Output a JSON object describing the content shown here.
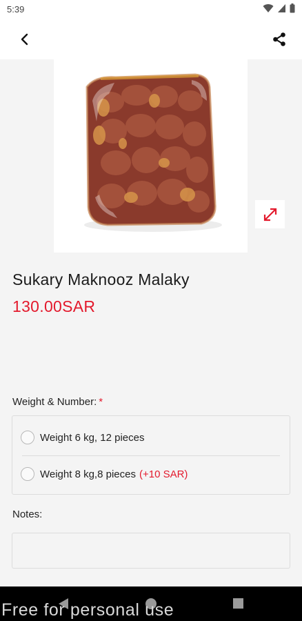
{
  "status_bar": {
    "time": "5:39",
    "icons": [
      "wifi-icon",
      "signal-icon",
      "battery-icon"
    ]
  },
  "app_bar": {
    "back_icon": "back-arrow-icon",
    "share_icon": "share-icon"
  },
  "product": {
    "image": "vacuum-packed dates product photo",
    "zoom_icon": "expand-diagonal-icon",
    "title": "Sukary Maknooz Malaky",
    "price": "130.00SAR"
  },
  "weight_section": {
    "label": "Weight & Number:",
    "required_mark": "*",
    "options": [
      {
        "label": "Weight 6 kg, 12 pieces",
        "extra": "",
        "selected": false
      },
      {
        "label": "Weight 8 kg,8 pieces",
        "extra": "(+10 SAR)",
        "selected": false
      }
    ]
  },
  "notes_section": {
    "label": "Notes:",
    "value": "",
    "placeholder": ""
  },
  "nav_bar": {
    "icons": [
      "nav-back-icon",
      "nav-home-icon",
      "nav-recent-icon"
    ]
  },
  "watermark": "Free for personal use",
  "colors": {
    "accent": "#e3192c",
    "background": "#f4f4f4",
    "surface": "#ffffff",
    "nav_bar": "#000000"
  }
}
